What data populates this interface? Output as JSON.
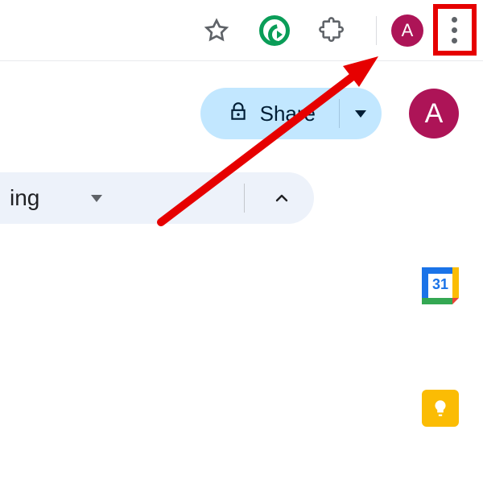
{
  "browser": {
    "avatar_letter": "A"
  },
  "app": {
    "share_label": "Share",
    "avatar_letter": "A"
  },
  "toolbar": {
    "editing_label": "ing"
  },
  "side": {
    "calendar_date": "31"
  },
  "annotation": {
    "highlight": "chrome-more-menu"
  }
}
